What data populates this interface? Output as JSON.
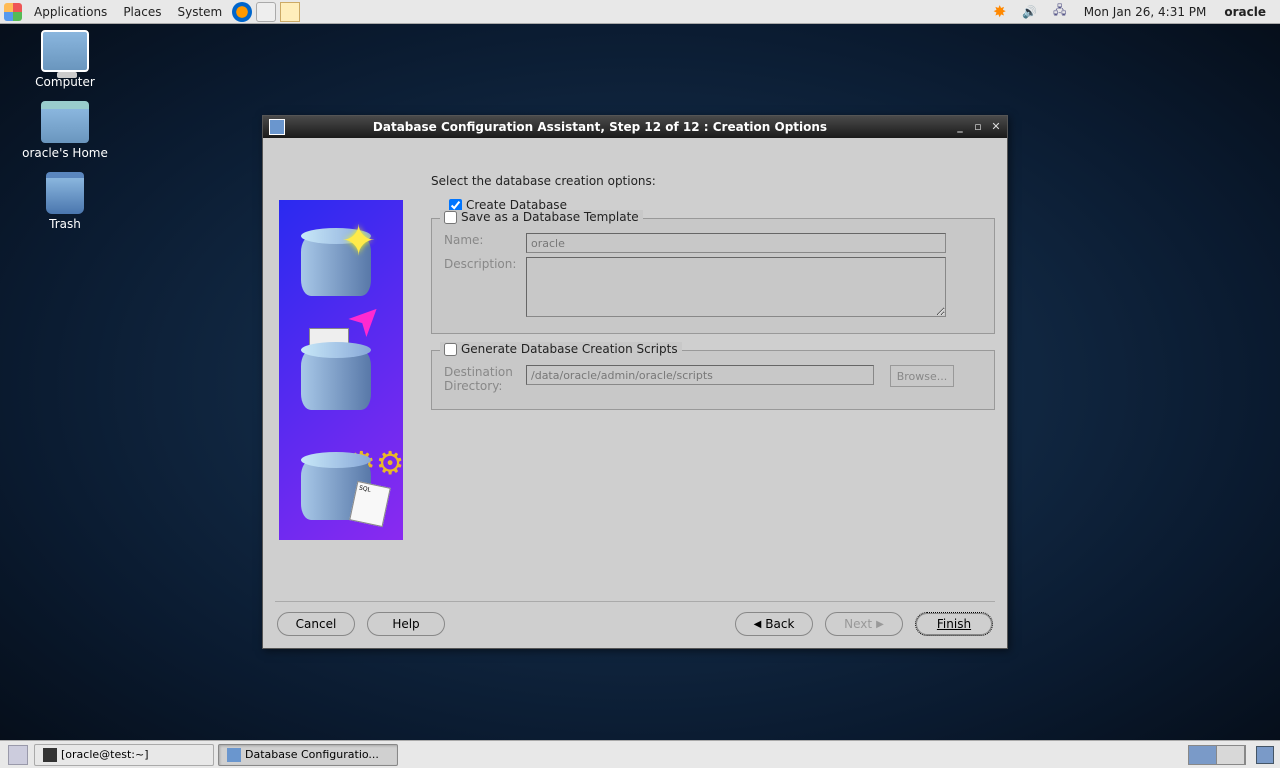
{
  "panel": {
    "menus": [
      "Applications",
      "Places",
      "System"
    ],
    "datetime": "Mon Jan 26,  4:31 PM",
    "user": "oracle"
  },
  "desktop": {
    "computer": "Computer",
    "home": "oracle's Home",
    "trash": "Trash"
  },
  "window": {
    "title": "Database Configuration Assistant, Step 12 of 12 : Creation Options",
    "instruction": "Select the database creation options:",
    "create_db_label": "Create Database",
    "create_db_checked": true,
    "template_group": {
      "legend": "Save as a Database Template",
      "checked": false,
      "name_label": "Name:",
      "name_value": "oracle",
      "desc_label": "Description:",
      "desc_value": ""
    },
    "scripts_group": {
      "legend": "Generate Database Creation Scripts",
      "checked": false,
      "dest_label_1": "Destination",
      "dest_label_2": "Directory:",
      "dest_value": "/data/oracle/admin/oracle/scripts",
      "browse_label": "Browse..."
    },
    "buttons": {
      "cancel": "Cancel",
      "help": "Help",
      "back": "Back",
      "next": "Next",
      "finish": "Finish"
    }
  },
  "taskbar": {
    "terminal": "[oracle@test:~]",
    "dbca": "Database Configuratio..."
  }
}
